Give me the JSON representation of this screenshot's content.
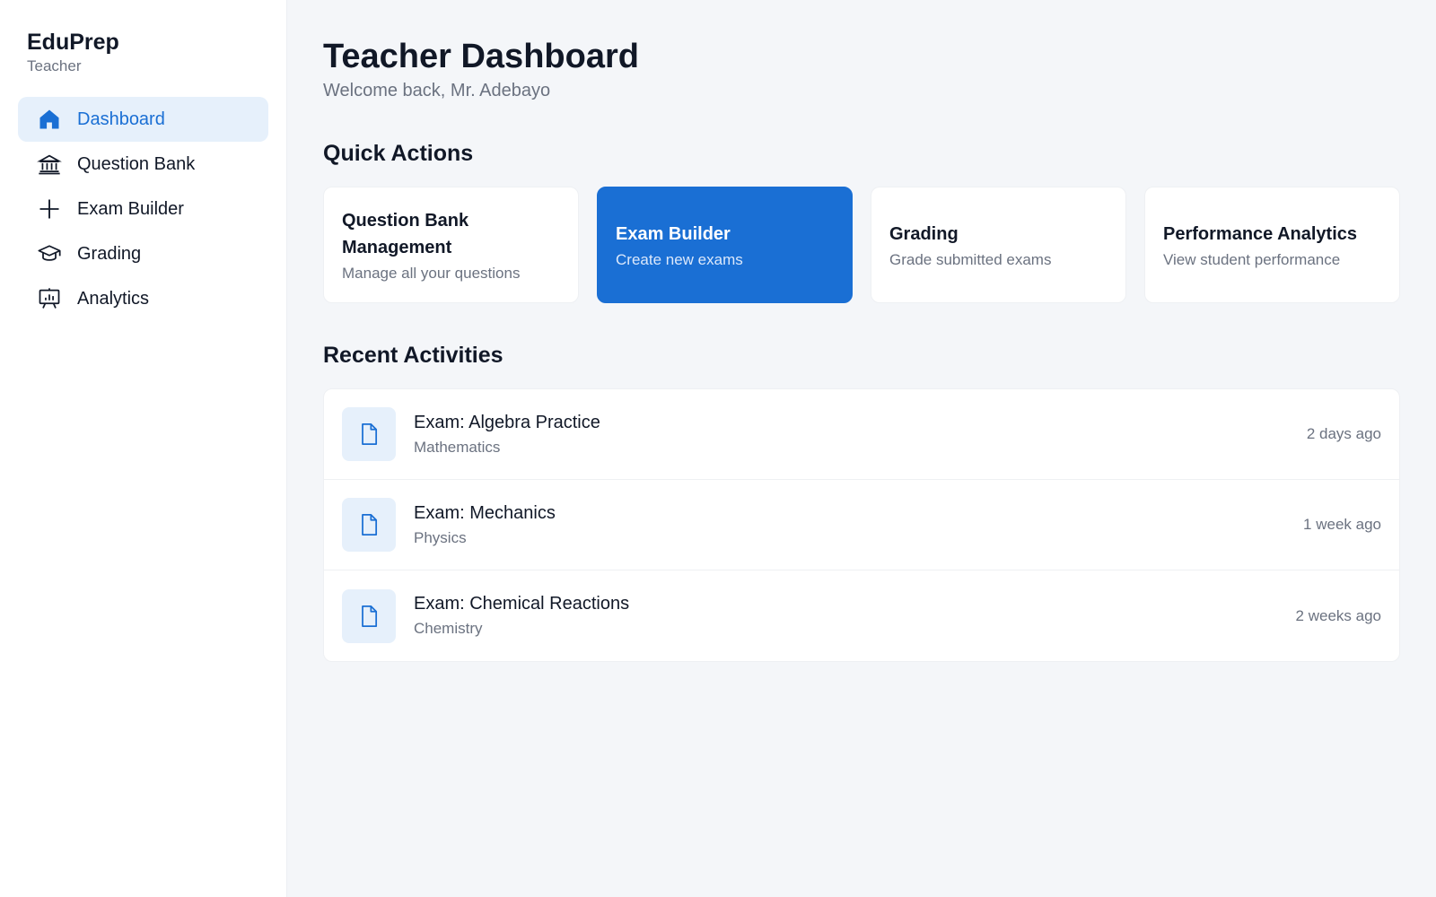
{
  "brand": {
    "name": "EduPrep",
    "role": "Teacher"
  },
  "sidebar": {
    "items": [
      {
        "label": "Dashboard",
        "icon": "home-icon",
        "active": true
      },
      {
        "label": "Question Bank",
        "icon": "bank-icon",
        "active": false
      },
      {
        "label": "Exam Builder",
        "icon": "plus-icon",
        "active": false
      },
      {
        "label": "Grading",
        "icon": "graduation-cap-icon",
        "active": false
      },
      {
        "label": "Analytics",
        "icon": "presentation-chart-icon",
        "active": false
      }
    ]
  },
  "header": {
    "title": "Teacher Dashboard",
    "subtitle": "Welcome back, Mr. Adebayo"
  },
  "quick_actions": {
    "title": "Quick Actions",
    "cards": [
      {
        "title": "Question Bank Management",
        "desc": "Manage all your questions",
        "highlighted": false
      },
      {
        "title": "Exam Builder",
        "desc": "Create new exams",
        "highlighted": true
      },
      {
        "title": "Grading",
        "desc": "Grade submitted exams",
        "highlighted": false
      },
      {
        "title": "Performance Analytics",
        "desc": "View student performance",
        "highlighted": false
      }
    ]
  },
  "recent": {
    "title": "Recent Activities",
    "items": [
      {
        "title": "Exam: Algebra Practice",
        "subject": "Mathematics",
        "time": "2 days ago",
        "icon": "document-icon"
      },
      {
        "title": "Exam: Mechanics",
        "subject": "Physics",
        "time": "1 week ago",
        "icon": "document-icon"
      },
      {
        "title": "Exam: Chemical Reactions",
        "subject": "Chemistry",
        "time": "2 weeks ago",
        "icon": "document-icon"
      }
    ]
  },
  "colors": {
    "accent": "#1a6fd4",
    "accent_light": "#e6f0fb",
    "background": "#f4f6f9",
    "muted_text": "#6b7280"
  }
}
